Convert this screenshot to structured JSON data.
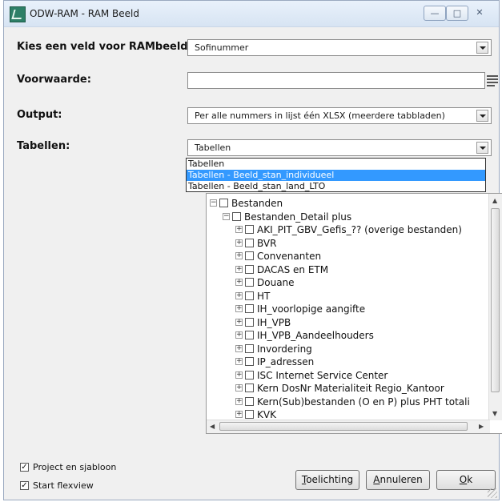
{
  "window": {
    "title": "ODW-RAM - RAM Beeld"
  },
  "form": {
    "veld_label": "Kies een veld voor RAMbeeld:",
    "veld_value": "Sofinummer",
    "voorwaarde_label": "Voorwaarde:",
    "voorwaarde_value": "",
    "output_label": "Output:",
    "output_value": "Per alle nummers in lijst één XLSX (meerdere tabbladen)",
    "tabellen_label": "Tabellen:",
    "tabellen_value": "Tabellen"
  },
  "dropdown": {
    "items": [
      "Tabellen",
      "Tabellen - Beeld_stan_individueel",
      "Tabellen - Beeld_stan_land_LTO"
    ],
    "selected_index": 1
  },
  "tree": {
    "items": [
      {
        "label": "Bestanden",
        "level": 0,
        "expander": "minus"
      },
      {
        "label": "Bestanden_Detail plus",
        "level": 1,
        "expander": "minus"
      },
      {
        "label": "AKI_PIT_GBV_Gefis_?? (overige bestanden)",
        "level": 2,
        "expander": "plus"
      },
      {
        "label": "BVR",
        "level": 2,
        "expander": "plus"
      },
      {
        "label": "Convenanten",
        "level": 2,
        "expander": "plus"
      },
      {
        "label": "DACAS en ETM",
        "level": 2,
        "expander": "plus"
      },
      {
        "label": "Douane",
        "level": 2,
        "expander": "plus"
      },
      {
        "label": "HT",
        "level": 2,
        "expander": "plus"
      },
      {
        "label": "IH_voorlopige aangifte",
        "level": 2,
        "expander": "plus"
      },
      {
        "label": "IH_VPB",
        "level": 2,
        "expander": "plus"
      },
      {
        "label": "IH_VPB_Aandeelhouders",
        "level": 2,
        "expander": "plus"
      },
      {
        "label": "Invordering",
        "level": 2,
        "expander": "plus"
      },
      {
        "label": "IP_adressen",
        "level": 2,
        "expander": "plus"
      },
      {
        "label": "ISC Internet Service Center",
        "level": 2,
        "expander": "plus"
      },
      {
        "label": "Kern DosNr Materialiteit Regio_Kantoor",
        "level": 2,
        "expander": "plus"
      },
      {
        "label": "Kern(Sub)bestanden (O en P) plus PHT totali",
        "level": 2,
        "expander": "plus"
      },
      {
        "label": "KVK",
        "level": 2,
        "expander": "plus"
      }
    ]
  },
  "options": {
    "project_label": "Project en sjabloon",
    "project_checked": true,
    "flexview_label": "Start flexview",
    "flexview_checked": true
  },
  "buttons": {
    "toelichting": {
      "underlined": "T",
      "rest": "oelichting"
    },
    "annuleren": {
      "underlined": "A",
      "rest": "nnuleren"
    },
    "ok": {
      "underlined": "O",
      "rest": "k"
    }
  }
}
